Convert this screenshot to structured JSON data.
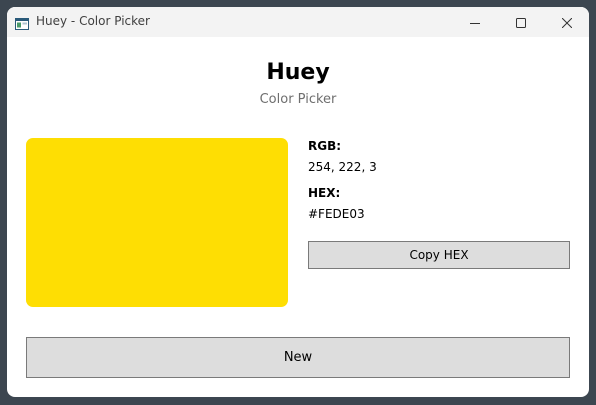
{
  "window": {
    "title": "Huey - Color Picker",
    "icon": "app-window-icon",
    "controls": [
      "minimize-icon",
      "maximize-icon",
      "close-icon"
    ]
  },
  "header": {
    "title": "Huey",
    "subtitle": "Color Picker"
  },
  "color": {
    "swatch_hex": "#FEDE03",
    "rgb_label": "RGB:",
    "rgb_value": "254, 222, 3",
    "hex_label": "HEX:",
    "hex_value": "#FEDE03"
  },
  "buttons": {
    "copy_hex": "Copy HEX",
    "new": "New"
  },
  "colors": {
    "window_background": "#ffffff",
    "titlebar_background": "#f3f3f3",
    "desktop_background": "#3c4650",
    "button_background": "#dddddd",
    "button_border": "#7a7a7a",
    "subtitle_text": "#6e6e6e"
  }
}
